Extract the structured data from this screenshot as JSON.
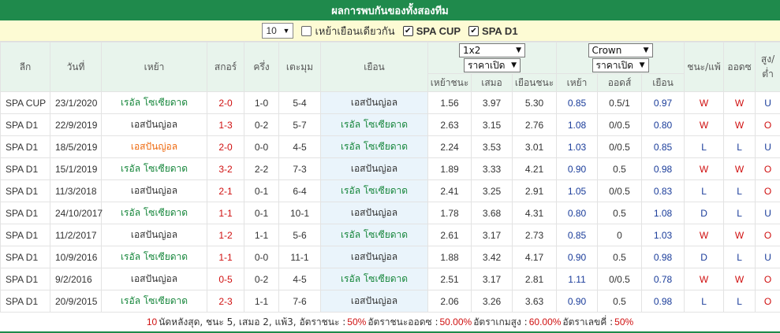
{
  "title": "ผลการพบกันของทั้งสองทีม",
  "filter": {
    "count_value": "10",
    "home_only_label": "เหย้าเยือนเดียวกัน",
    "home_only_checked": false,
    "leagues": [
      {
        "label": "SPA CUP",
        "checked": true
      },
      {
        "label": "SPA D1",
        "checked": true
      }
    ]
  },
  "headers": {
    "league": "ลีก",
    "date": "วันที่",
    "home": "เหย้า",
    "score": "สกอร์",
    "half": "ครึ่ง",
    "corner": "เตะมุม",
    "away": "เยือน",
    "odds_group1_select": "1x2",
    "odds_group1_price": "ราคาเปิด",
    "odds_group2_select": "Crown",
    "odds_group2_price": "ราคาเปิด",
    "win_lose": "ชนะ/แพ้",
    "ah_result": "ออดซ",
    "ou_result": "สูง/ต่ำ",
    "sub_home_win": "เหย้าชนะ",
    "sub_draw": "เสมอ",
    "sub_away_win": "เยือนชนะ",
    "sub_home": "เหย้า",
    "sub_odds": "ออดส์",
    "sub_away": "เยือน"
  },
  "colors": {
    "header_green": "#1f8a4c",
    "win_red": "#d01010",
    "loss_blue": "#1a3c9a",
    "home_team_green": "#16863b",
    "away_team_orange": "#ee6a10"
  },
  "rows": [
    {
      "league": "SPA CUP",
      "date": "23/1/2020",
      "home": "เรอัล โซเซียดาด",
      "home_hl": "home-hi",
      "score": "2-0",
      "half": "1-0",
      "corner": "5-4",
      "away": "เอสปันญ่อล",
      "away_hl": "",
      "o1": "1.56",
      "ox": "3.97",
      "o2": "5.30",
      "h": "0.85",
      "ah": "0.5/1",
      "a": "0.97",
      "wl": "W",
      "ahr": "W",
      "ou": "U"
    },
    {
      "league": "SPA D1",
      "date": "22/9/2019",
      "home": "เอสปันญ่อล",
      "home_hl": "",
      "score": "1-3",
      "half": "0-2",
      "corner": "5-7",
      "away": "เรอัล โซเซียดาด",
      "away_hl": "home-hi",
      "o1": "2.63",
      "ox": "3.15",
      "o2": "2.76",
      "h": "1.08",
      "ah": "0/0.5",
      "a": "0.80",
      "wl": "W",
      "ahr": "W",
      "ou": "O"
    },
    {
      "league": "SPA D1",
      "date": "18/5/2019",
      "home": "เอสปันญ่อล",
      "home_hl": "away-hi",
      "score": "2-0",
      "half": "0-0",
      "corner": "4-5",
      "away": "เรอัล โซเซียดาด",
      "away_hl": "home-hi",
      "o1": "2.24",
      "ox": "3.53",
      "o2": "3.01",
      "h": "1.03",
      "ah": "0/0.5",
      "a": "0.85",
      "wl": "L",
      "ahr": "L",
      "ou": "U"
    },
    {
      "league": "SPA D1",
      "date": "15/1/2019",
      "home": "เรอัล โซเซียดาด",
      "home_hl": "home-hi",
      "score": "3-2",
      "half": "2-2",
      "corner": "7-3",
      "away": "เอสปันญ่อล",
      "away_hl": "",
      "o1": "1.89",
      "ox": "3.33",
      "o2": "4.21",
      "h": "0.90",
      "ah": "0.5",
      "a": "0.98",
      "wl": "W",
      "ahr": "W",
      "ou": "O"
    },
    {
      "league": "SPA D1",
      "date": "11/3/2018",
      "home": "เอสปันญ่อล",
      "home_hl": "",
      "score": "2-1",
      "half": "0-1",
      "corner": "6-4",
      "away": "เรอัล โซเซียดาด",
      "away_hl": "home-hi",
      "o1": "2.41",
      "ox": "3.25",
      "o2": "2.91",
      "h": "1.05",
      "ah": "0/0.5",
      "a": "0.83",
      "wl": "L",
      "ahr": "L",
      "ou": "O"
    },
    {
      "league": "SPA D1",
      "date": "24/10/2017",
      "home": "เรอัล โซเซียดาด",
      "home_hl": "home-hi",
      "score": "1-1",
      "half": "0-1",
      "corner": "10-1",
      "away": "เอสปันญ่อล",
      "away_hl": "",
      "o1": "1.78",
      "ox": "3.68",
      "o2": "4.31",
      "h": "0.80",
      "ah": "0.5",
      "a": "1.08",
      "wl": "D",
      "ahr": "L",
      "ou": "U"
    },
    {
      "league": "SPA D1",
      "date": "11/2/2017",
      "home": "เอสปันญ่อล",
      "home_hl": "",
      "score": "1-2",
      "half": "1-1",
      "corner": "5-6",
      "away": "เรอัล โซเซียดาด",
      "away_hl": "home-hi",
      "o1": "2.61",
      "ox": "3.17",
      "o2": "2.73",
      "h": "0.85",
      "ah": "0",
      "a": "1.03",
      "wl": "W",
      "ahr": "W",
      "ou": "O"
    },
    {
      "league": "SPA D1",
      "date": "10/9/2016",
      "home": "เรอัล โซเซียดาด",
      "home_hl": "home-hi",
      "score": "1-1",
      "half": "0-0",
      "corner": "11-1",
      "away": "เอสปันญ่อล",
      "away_hl": "",
      "o1": "1.88",
      "ox": "3.42",
      "o2": "4.17",
      "h": "0.90",
      "ah": "0.5",
      "a": "0.98",
      "wl": "D",
      "ahr": "L",
      "ou": "U"
    },
    {
      "league": "SPA D1",
      "date": "9/2/2016",
      "home": "เอสปันญ่อล",
      "home_hl": "",
      "score": "0-5",
      "half": "0-2",
      "corner": "4-5",
      "away": "เรอัล โซเซียดาด",
      "away_hl": "home-hi",
      "o1": "2.51",
      "ox": "3.17",
      "o2": "2.81",
      "h": "1.11",
      "ah": "0/0.5",
      "a": "0.78",
      "wl": "W",
      "ahr": "W",
      "ou": "O"
    },
    {
      "league": "SPA D1",
      "date": "20/9/2015",
      "home": "เรอัล โซเซียดาด",
      "home_hl": "home-hi",
      "score": "2-3",
      "half": "1-1",
      "corner": "7-6",
      "away": "เอสปันญ่อล",
      "away_hl": "",
      "o1": "2.06",
      "ox": "3.26",
      "o2": "3.63",
      "h": "0.90",
      "ah": "0.5",
      "a": "0.98",
      "wl": "L",
      "ahr": "L",
      "ou": "O"
    }
  ],
  "summary": {
    "count": "10",
    "text1": "นัดหลังสุด, ชนะ 5, เสมอ 2, แพ้3, อัตราชนะ :",
    "win_rate": "50%",
    "text2": "อัตราชนะออดซ :",
    "ah_rate": "50.00%",
    "text3": "อัตราเกมสูง :",
    "over_rate": "60.00%",
    "text4": "อัตราเลขคี่ :",
    "odd_rate": "50%"
  }
}
